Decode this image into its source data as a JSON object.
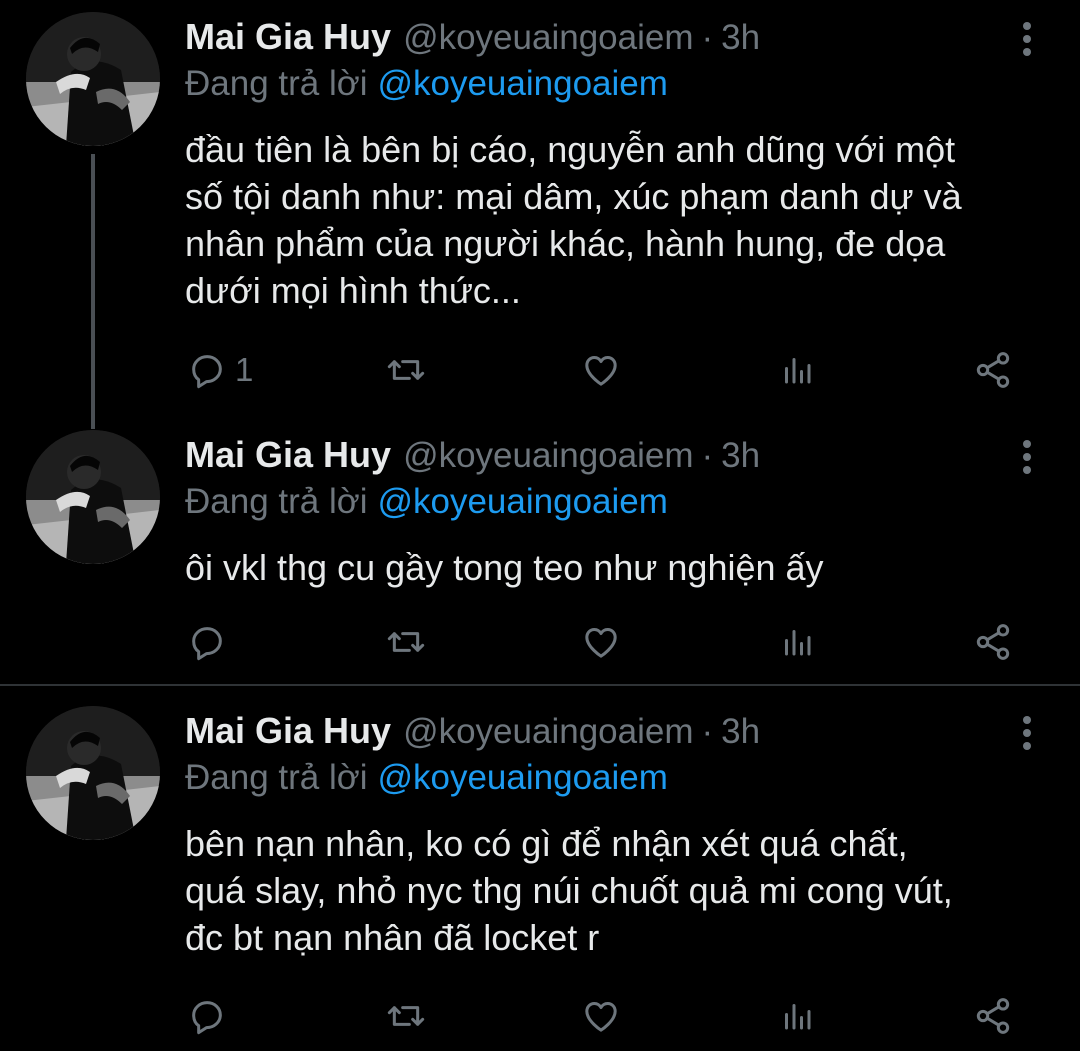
{
  "colors": {
    "background": "#000000",
    "text": "#e7e9ea",
    "muted": "#6e767d",
    "mention": "#1d9bf0",
    "divider": "#2f3336"
  },
  "tweets": [
    {
      "name": "Mai Gia Huy",
      "handle": "@koyeuaingoaiem",
      "dot": "·",
      "time": "3h",
      "replying_label": "Đang trả lời",
      "replying_to": "@koyeuaingoaiem",
      "lines": [
        "đầu tiên là bên bị cáo, nguyễn anh dũng với một",
        "số tội danh như: mại dâm, xúc phạm danh dự và",
        "nhân phẩm của người khác, hành hung, đe dọa",
        "dưới mọi hình thức..."
      ],
      "reply_count": "1",
      "icons": [
        "reply-icon",
        "retweet-icon",
        "like-icon",
        "analytics-icon",
        "share-icon"
      ]
    },
    {
      "name": "Mai Gia Huy",
      "handle": "@koyeuaingoaiem",
      "dot": "·",
      "time": "3h",
      "replying_label": "Đang trả lời",
      "replying_to": "@koyeuaingoaiem",
      "lines": [
        "ôi vkl thg cu gầy tong teo như nghiện ấy"
      ],
      "reply_count": "",
      "icons": [
        "reply-icon",
        "retweet-icon",
        "like-icon",
        "analytics-icon",
        "share-icon"
      ]
    },
    {
      "name": "Mai Gia Huy",
      "handle": "@koyeuaingoaiem",
      "dot": "·",
      "time": "3h",
      "replying_label": "Đang trả lời",
      "replying_to": "@koyeuaingoaiem",
      "lines": [
        "bên nạn nhân, ko có gì để nhận xét quá chất,",
        "quá slay, nhỏ nyc thg núi chuốt quả mi cong vút,",
        "đc bt nạn nhân đã locket r"
      ],
      "reply_count": "",
      "icons": [
        "reply-icon",
        "retweet-icon",
        "like-icon",
        "analytics-icon",
        "share-icon"
      ]
    }
  ]
}
